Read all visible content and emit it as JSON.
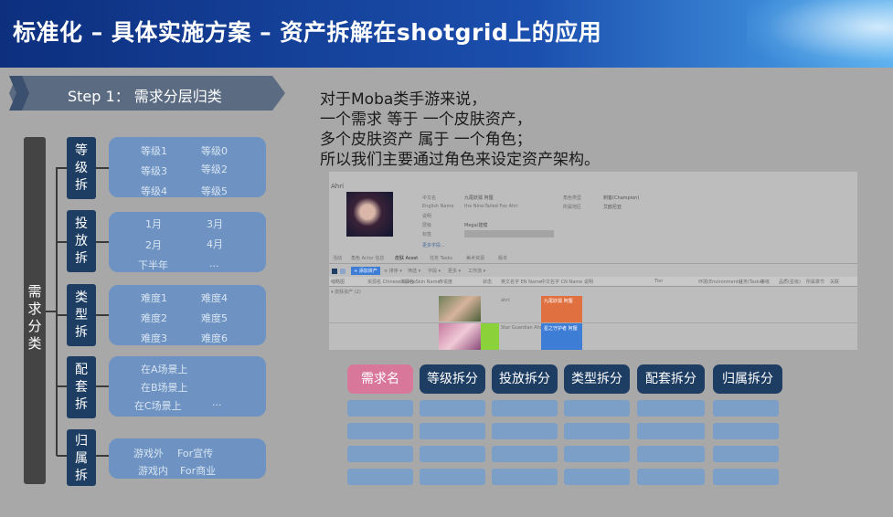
{
  "header": {
    "title": "标准化 – 具体实施方案 – 资产拆解在shotgrid上的应用"
  },
  "step": {
    "label": "Step 1： 需求分层归类"
  },
  "tree": {
    "root": "需求分类",
    "categories": [
      {
        "label": "等级拆分",
        "options": [
          "等级1",
          "等级0",
          "等级3",
          "等级2",
          "等级4",
          "等级5"
        ]
      },
      {
        "label": "投放拆分",
        "options": [
          "1月",
          "3月",
          "2月",
          "4月",
          "下半年",
          "..."
        ]
      },
      {
        "label": "类型拆分",
        "options": [
          "难度1",
          "难度4",
          "难度2",
          "难度5",
          "难度3",
          "难度6"
        ]
      },
      {
        "label": "配套拆分",
        "options": [
          "在A场景上",
          "在B场景上",
          "在C场景上",
          "..."
        ]
      },
      {
        "label": "归属拆分",
        "options": [
          "游戏外",
          "For宣传",
          "游戏内",
          "For商业"
        ]
      }
    ]
  },
  "description": [
    "对于Moba类手游来说，",
    "一个需求 等于  一个皮肤资产，",
    "多个皮肤资产 属于 一个角色；",
    "所以我们主要通过角色来设定资产架构。"
  ],
  "shotgrid": {
    "asset_name": "Ahri",
    "fields": [
      "中文名",
      "English Name",
      "说明",
      "层级",
      "标签"
    ],
    "values": [
      "九尾妖狐 阿狸",
      "the Nine-Tailed Fox Ahri",
      "",
      "Mega/建模"
    ],
    "right_fields": [
      "角色类型",
      "所属地区"
    ],
    "right_values": [
      "刺客(Champion)",
      "艾欧尼亚"
    ],
    "more_fields": "更多字段...",
    "tabs": [
      "活动",
      "角色 Actor 信息",
      "皮肤 Asset",
      "任务 Tasks",
      "美术资源",
      "版本"
    ],
    "toolbar": [
      "+ 添加资产",
      "≡ 排序 ▾",
      "筛选 ▾",
      "字段 ▾",
      "更多 ▾",
      "工作流 ▾"
    ],
    "columns": [
      "缩略图",
      "资源名 Chinese Name",
      "资源名 Skin Name",
      "传说度",
      "状态",
      "英文名字 EN Name",
      "中文名字 CN Name",
      "说明",
      "Tier",
      "环境(Environments)",
      "任务(Tasks)",
      "等级",
      "品质(星级)",
      "所属章节",
      "关联"
    ],
    "group": "▾ 皮肤资产 (2)",
    "rows": [
      {
        "name": "ahri",
        "note": "九尾妖狐 阿狸"
      },
      {
        "name": "Star Guardian Ahri",
        "note": "星之守护者 阿狸"
      }
    ]
  },
  "table_headers": [
    "需求名",
    "等级拆分",
    "投放拆分",
    "类型拆分",
    "配套拆分",
    "归属拆分"
  ],
  "colors": {
    "header_dark": "#0d2f7e",
    "tag_pink": "#d9779a",
    "tag_navy": "#1e3d63",
    "box_blue": "#6e93c2",
    "cell_blue": "#7c9fc8",
    "orange": "#e07040",
    "blue": "#3d7dd6",
    "green": "#8bd23a"
  }
}
